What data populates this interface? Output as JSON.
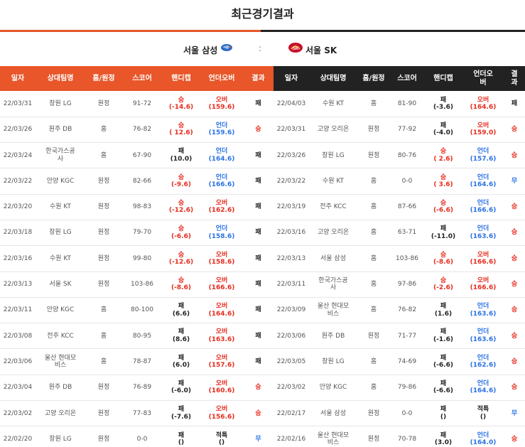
{
  "page_title": "최근경기결과",
  "team_left": {
    "name": "서울 삼성",
    "logo": "samsung-thunders-logo"
  },
  "vs": ":",
  "team_right": {
    "name": "서울 SK",
    "logo": "sk-knights-logo"
  },
  "colors": {
    "accent": "#e8562a",
    "dark": "#222222",
    "red": "#e62b1e",
    "blue": "#2a72e5"
  },
  "left_headers": [
    "일자",
    "상대팀명",
    "홈/원정",
    "스코어",
    "핸디캡",
    "언더오버",
    "결과"
  ],
  "right_headers": [
    "일자",
    "상대팀명",
    "홈/원정",
    "스코어",
    "핸디캡",
    "언더오\n버",
    "결\n과"
  ],
  "left_rows": [
    {
      "date": "22/03/31",
      "opp": "창원 LG",
      "ha": "원정",
      "score": "91-72",
      "hc": "승",
      "hcv": "(-14.6)",
      "hcc": "red",
      "ou": "오버",
      "ouv": "(159.6)",
      "ouc": "red",
      "res": "패",
      "rc": "lose"
    },
    {
      "date": "22/03/26",
      "opp": "원주 DB",
      "ha": "홈",
      "score": "76-82",
      "hc": "승",
      "hcv": "( 12.6)",
      "hcc": "red",
      "ou": "언더",
      "ouv": "(159.6)",
      "ouc": "blue",
      "res": "승",
      "rc": "win"
    },
    {
      "date": "22/03/24",
      "opp": "한국가스공\n사",
      "ha": "홈",
      "score": "67-90",
      "hc": "패",
      "hcv": "(10.0)",
      "hcc": "dark",
      "ou": "언더",
      "ouv": "(164.6)",
      "ouc": "blue",
      "res": "패",
      "rc": "lose"
    },
    {
      "date": "22/03/22",
      "opp": "안양 KGC",
      "ha": "원정",
      "score": "82-66",
      "hc": "승",
      "hcv": "(-9.6)",
      "hcc": "red",
      "ou": "언더",
      "ouv": "(166.6)",
      "ouc": "blue",
      "res": "패",
      "rc": "lose"
    },
    {
      "date": "22/03/20",
      "opp": "수원 KT",
      "ha": "원정",
      "score": "98-83",
      "hc": "승",
      "hcv": "(-12.6)",
      "hcc": "red",
      "ou": "오버",
      "ouv": "(162.6)",
      "ouc": "red",
      "res": "패",
      "rc": "lose"
    },
    {
      "date": "22/03/18",
      "opp": "창원 LG",
      "ha": "원정",
      "score": "79-70",
      "hc": "승",
      "hcv": "(-6.6)",
      "hcc": "red",
      "ou": "언더",
      "ouv": "(158.6)",
      "ouc": "blue",
      "res": "패",
      "rc": "lose"
    },
    {
      "date": "22/03/16",
      "opp": "수원 KT",
      "ha": "원정",
      "score": "99-80",
      "hc": "승",
      "hcv": "(-12.6)",
      "hcc": "red",
      "ou": "오버",
      "ouv": "(158.6)",
      "ouc": "red",
      "res": "패",
      "rc": "lose"
    },
    {
      "date": "22/03/13",
      "opp": "서울 SK",
      "ha": "원정",
      "score": "103-86",
      "hc": "승",
      "hcv": "(-8.6)",
      "hcc": "red",
      "ou": "오버",
      "ouv": "(166.6)",
      "ouc": "red",
      "res": "패",
      "rc": "lose"
    },
    {
      "date": "22/03/11",
      "opp": "안양 KGC",
      "ha": "홈",
      "score": "80-100",
      "hc": "패",
      "hcv": "(6.6)",
      "hcc": "dark",
      "ou": "오버",
      "ouv": "(164.6)",
      "ouc": "red",
      "res": "패",
      "rc": "lose"
    },
    {
      "date": "22/03/08",
      "opp": "전주 KCC",
      "ha": "홈",
      "score": "80-95",
      "hc": "패",
      "hcv": "(8.6)",
      "hcc": "dark",
      "ou": "오버",
      "ouv": "(163.6)",
      "ouc": "red",
      "res": "패",
      "rc": "lose"
    },
    {
      "date": "22/03/06",
      "opp": "울산 현대모\n비스",
      "ha": "홈",
      "score": "78-87",
      "hc": "패",
      "hcv": "(6.0)",
      "hcc": "dark",
      "ou": "오버",
      "ouv": "(157.6)",
      "ouc": "red",
      "res": "패",
      "rc": "lose"
    },
    {
      "date": "22/03/04",
      "opp": "원주 DB",
      "ha": "원정",
      "score": "76-89",
      "hc": "패",
      "hcv": "(-6.0)",
      "hcc": "dark",
      "ou": "오버",
      "ouv": "(160.6)",
      "ouc": "red",
      "res": "승",
      "rc": "win"
    },
    {
      "date": "22/03/02",
      "opp": "고양 오리온",
      "ha": "원정",
      "score": "77-83",
      "hc": "패",
      "hcv": "(-7.6)",
      "hcc": "dark",
      "ou": "오버",
      "ouv": "(156.6)",
      "ouc": "red",
      "res": "승",
      "rc": "win"
    },
    {
      "date": "22/02/20",
      "opp": "창원 LG",
      "ha": "원정",
      "score": "0-0",
      "hc": "패",
      "hcv": "()",
      "hcc": "dark",
      "ou": "적특",
      "ouv": "()",
      "ouc": "dark",
      "res": "무",
      "rc": "draw"
    }
  ],
  "right_rows": [
    {
      "date": "22/04/03",
      "opp": "수원 KT",
      "ha": "홈",
      "score": "81-90",
      "hc": "패",
      "hcv": "(-3.6)",
      "hcc": "dark",
      "ou": "오버",
      "ouv": "(164.6)",
      "ouc": "red",
      "res": "패",
      "rc": "lose"
    },
    {
      "date": "22/03/31",
      "opp": "고양 오리온",
      "ha": "원정",
      "score": "77-92",
      "hc": "패",
      "hcv": "(-4.0)",
      "hcc": "dark",
      "ou": "오버",
      "ouv": "(159.0)",
      "ouc": "red",
      "res": "승",
      "rc": "win"
    },
    {
      "date": "22/03/26",
      "opp": "창원 LG",
      "ha": "원정",
      "score": "80-76",
      "hc": "승",
      "hcv": "( 2.6)",
      "hcc": "red",
      "ou": "언더",
      "ouv": "(157.6)",
      "ouc": "blue",
      "res": "승",
      "rc": "win"
    },
    {
      "date": "22/03/22",
      "opp": "수원 KT",
      "ha": "홈",
      "score": "0-0",
      "hc": "승",
      "hcv": "( 3.6)",
      "hcc": "red",
      "ou": "언더",
      "ouv": "(164.6)",
      "ouc": "blue",
      "res": "무",
      "rc": "draw"
    },
    {
      "date": "22/03/19",
      "opp": "전주 KCC",
      "ha": "홈",
      "score": "87-66",
      "hc": "승",
      "hcv": "(-6.6)",
      "hcc": "red",
      "ou": "언더",
      "ouv": "(166.6)",
      "ouc": "blue",
      "res": "승",
      "rc": "win"
    },
    {
      "date": "22/03/16",
      "opp": "고양 오리온",
      "ha": "홈",
      "score": "63-71",
      "hc": "패",
      "hcv": "(-11.0)",
      "hcc": "dark",
      "ou": "언더",
      "ouv": "(163.6)",
      "ouc": "blue",
      "res": "승",
      "rc": "win"
    },
    {
      "date": "22/03/13",
      "opp": "서울 삼성",
      "ha": "홈",
      "score": "103-86",
      "hc": "승",
      "hcv": "(-8.6)",
      "hcc": "red",
      "ou": "오버",
      "ouv": "(166.6)",
      "ouc": "red",
      "res": "승",
      "rc": "win"
    },
    {
      "date": "22/03/11",
      "opp": "한국가스공\n사",
      "ha": "홈",
      "score": "97-86",
      "hc": "승",
      "hcv": "(-2.6)",
      "hcc": "red",
      "ou": "오버",
      "ouv": "(166.6)",
      "ouc": "red",
      "res": "승",
      "rc": "win"
    },
    {
      "date": "22/03/09",
      "opp": "울산 현대모\n비스",
      "ha": "홈",
      "score": "76-82",
      "hc": "패",
      "hcv": "(1.6)",
      "hcc": "dark",
      "ou": "언더",
      "ouv": "(163.6)",
      "ouc": "blue",
      "res": "승",
      "rc": "win"
    },
    {
      "date": "22/03/06",
      "opp": "원주 DB",
      "ha": "원정",
      "score": "71-77",
      "hc": "패",
      "hcv": "(-1.6)",
      "hcc": "dark",
      "ou": "언더",
      "ouv": "(163.6)",
      "ouc": "blue",
      "res": "승",
      "rc": "win"
    },
    {
      "date": "22/03/05",
      "opp": "창원 LG",
      "ha": "홈",
      "score": "74-69",
      "hc": "패",
      "hcv": "(-6.6)",
      "hcc": "dark",
      "ou": "언더",
      "ouv": "(162.6)",
      "ouc": "blue",
      "res": "승",
      "rc": "win"
    },
    {
      "date": "22/03/02",
      "opp": "안양 KGC",
      "ha": "홈",
      "score": "79-86",
      "hc": "패",
      "hcv": "(-6.6)",
      "hcc": "dark",
      "ou": "언더",
      "ouv": "(164.6)",
      "ouc": "blue",
      "res": "승",
      "rc": "win"
    },
    {
      "date": "22/02/17",
      "opp": "서울 삼성",
      "ha": "원정",
      "score": "0-0",
      "hc": "패",
      "hcv": "()",
      "hcc": "dark",
      "ou": "적특",
      "ouv": "()",
      "ouc": "dark",
      "res": "무",
      "rc": "draw"
    },
    {
      "date": "22/02/16",
      "opp": "울산 현대모\n비스",
      "ha": "원정",
      "score": "70-78",
      "hc": "패",
      "hcv": "(3.0)",
      "hcc": "dark",
      "ou": "언더",
      "ouv": "(164.0)",
      "ouc": "blue",
      "res": "승",
      "rc": "win"
    }
  ]
}
